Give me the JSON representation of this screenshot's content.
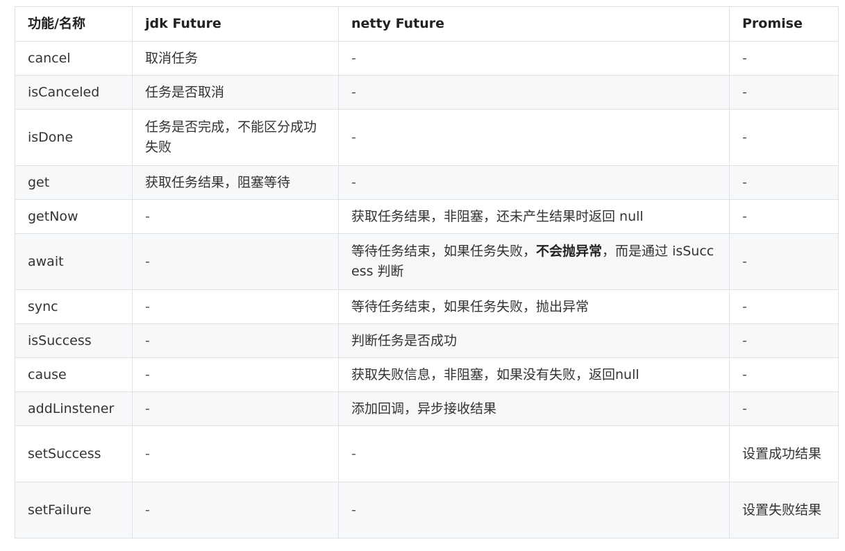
{
  "table": {
    "headers": [
      "功能/名称",
      "jdk Future",
      "netty Future",
      "Promise"
    ],
    "rows": [
      {
        "name": "cancel",
        "jdk": "取消任务",
        "netty": "-",
        "promise": "-"
      },
      {
        "name": "isCanceled",
        "jdk": "任务是否取消",
        "netty": "-",
        "promise": "-"
      },
      {
        "name": "isDone",
        "jdk": "任务是否完成，不能区分成功失败",
        "netty": "-",
        "promise": "-"
      },
      {
        "name": "get",
        "jdk": "获取任务结果，阻塞等待",
        "netty": "-",
        "promise": "-"
      },
      {
        "name": "getNow",
        "jdk": "-",
        "netty": "获取任务结果，非阻塞，还未产生结果时返回 null",
        "promise": "-"
      },
      {
        "name": "await",
        "jdk": "-",
        "netty_pre": "等待任务结束，如果任务失败，",
        "netty_bold": "不会抛异常",
        "netty_post": "，而是通过 isSuccess 判断",
        "promise": "-"
      },
      {
        "name": "sync",
        "jdk": "-",
        "netty": "等待任务结束，如果任务失败，抛出异常",
        "promise": "-"
      },
      {
        "name": "isSuccess",
        "jdk": "-",
        "netty": "判断任务是否成功",
        "promise": "-"
      },
      {
        "name": "cause",
        "jdk": "-",
        "netty": "获取失败信息，非阻塞，如果没有失败，返回null",
        "promise": "-"
      },
      {
        "name": "addLinstener",
        "jdk": "-",
        "netty": "添加回调，异步接收结果",
        "promise": "-"
      },
      {
        "name": "setSuccess",
        "jdk": "-",
        "netty": "-",
        "promise": "设置成功结果"
      },
      {
        "name": "setFailure",
        "jdk": "-",
        "netty": "-",
        "promise": "设置失败结果"
      }
    ]
  }
}
